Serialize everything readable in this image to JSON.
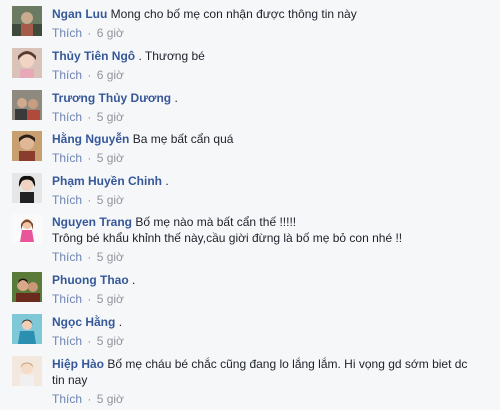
{
  "comments": [
    {
      "author": "Ngan Luu",
      "text": "Mong cho bố mẹ con nhận được thông tin này",
      "text2": "",
      "like": "Thích",
      "sep": "·",
      "time": "6 giờ"
    },
    {
      "author": "Thủy Tiên Ngô",
      "text": ". Thương bé",
      "text2": "",
      "like": "Thích",
      "sep": "·",
      "time": "6 giờ"
    },
    {
      "author": "Trương Thủy Dương",
      "text": ".",
      "text2": "",
      "like": "Thích",
      "sep": "·",
      "time": "5 giờ"
    },
    {
      "author": "Hằng Nguyễn",
      "text": "Ba mẹ bất cẩn quá",
      "text2": "",
      "like": "Thích",
      "sep": "·",
      "time": "5 giờ"
    },
    {
      "author": "Phạm Huyền Chinh",
      "text": ".",
      "text2": "",
      "like": "Thích",
      "sep": "·",
      "time": "5 giờ"
    },
    {
      "author": "Nguyen Trang",
      "text": "Bố mẹ nào mà bất cẩn thế !!!!!",
      "text2": "Trông bé khẩu khỉnh thế này,cầu giời đừng là bố mẹ bỏ con nhé !!",
      "like": "Thích",
      "sep": "·",
      "time": "5 giờ"
    },
    {
      "author": "Phuong Thao",
      "text": ".",
      "text2": "",
      "like": "Thích",
      "sep": "·",
      "time": "5 giờ"
    },
    {
      "author": "Ngọc Hằng",
      "text": ".",
      "text2": "",
      "like": "Thích",
      "sep": "·",
      "time": "5 giờ"
    },
    {
      "author": "Hiệp Hào",
      "text": "Bố mẹ cháu bé chắc cũng đang lo lắng lắm. Hi vọng gd sớm biet dc",
      "text2": "tin nay",
      "like": "Thích",
      "sep": "·",
      "time": "5 giờ"
    }
  ],
  "colors": {
    "author": "#365899",
    "like": "#6d84b4",
    "meta": "#90949c",
    "text": "#1d2129",
    "background": "#f6f7f9"
  }
}
